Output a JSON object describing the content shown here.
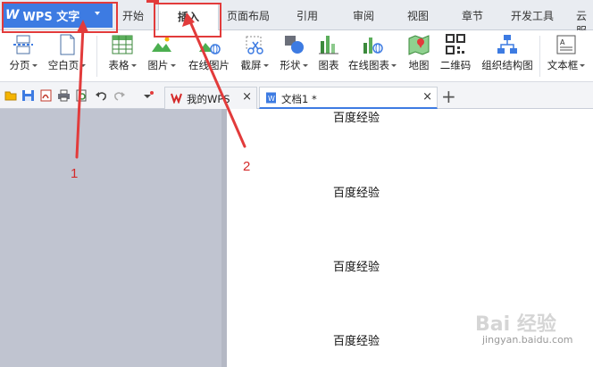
{
  "app": {
    "title": "WPS 文字"
  },
  "menu_tabs": [
    "开始",
    "插入",
    "页面布局",
    "引用",
    "审阅",
    "视图",
    "章节",
    "开发工具",
    "云服"
  ],
  "ribbon": {
    "page_break": "分页",
    "blank_page": "空白页",
    "table": "表格",
    "picture": "图片",
    "online_picture": "在线图片",
    "screenshot": "截屏",
    "shapes": "形状",
    "chart": "图表",
    "online_chart": "在线图表",
    "map": "地图",
    "qrcode": "二维码",
    "org_chart": "组织结构图",
    "textbox": "文本框"
  },
  "doc_tabs": [
    {
      "label": "我的WPS",
      "close": "×"
    },
    {
      "label": "文档1 *",
      "close": "×"
    }
  ],
  "new_tab": "+",
  "document": {
    "paragraphs": [
      "百度经验",
      "百度经验",
      "百度经验",
      "百度经验"
    ]
  },
  "annotations": {
    "marker1": "1",
    "marker2": "2"
  },
  "watermark": {
    "text": "jingyan.baidu.com",
    "logo": "Bai 经验"
  },
  "colors": {
    "accent": "#3d7be2",
    "annotation": "#e23b3b",
    "menubar_bg": "#e9ecf1",
    "doc_bg": "#c0c4d0"
  }
}
